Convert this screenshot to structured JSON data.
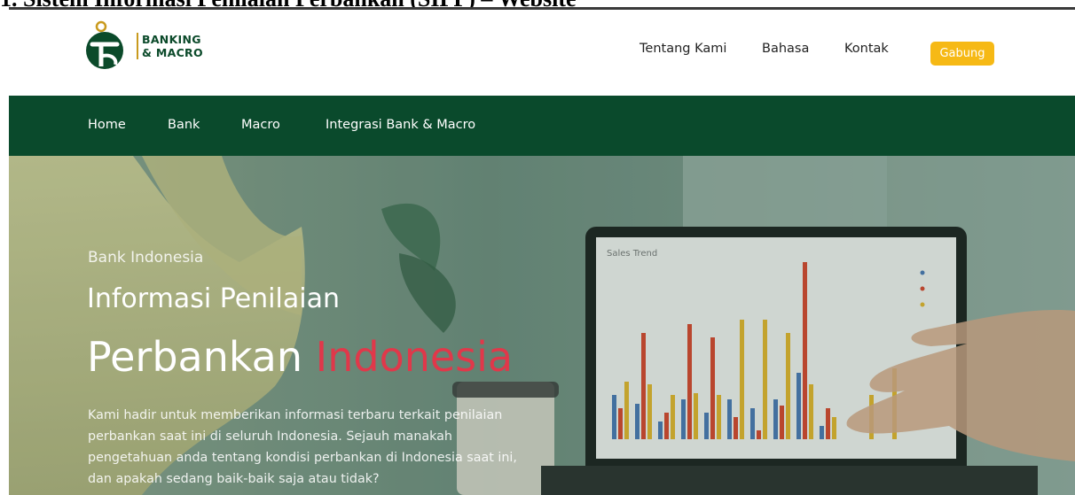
{
  "caption": "1. Sistem Informasi Penilaian Perbankan (SIPP) – Website",
  "brand": {
    "line1": "BANKING",
    "line2": "& MACRO"
  },
  "top_nav": [
    {
      "label": "Tentang Kami"
    },
    {
      "label": "Bahasa"
    },
    {
      "label": "Kontak"
    }
  ],
  "cta": {
    "label": "Gabung"
  },
  "main_nav": [
    {
      "label": "Home"
    },
    {
      "label": "Bank"
    },
    {
      "label": "Macro"
    },
    {
      "label": "Integrasi Bank & Macro"
    }
  ],
  "hero": {
    "eyebrow": "Bank Indonesia",
    "title_line1": "Informasi Penilaian",
    "title_line2_main": "Perbankan",
    "title_line2_accent": "Indonesia",
    "body_lines": [
      "Kami hadir untuk memberikan informasi terbaru terkait penilaian",
      "perbankan saat ini di seluruh Indonesia. Sejauh manakah",
      "pengetahuan anda tentang kondisi perbankan di Indonesia saat ini,",
      "dan apakah sedang baik-baik saja atau tidak?"
    ],
    "screen_label": "Sales Trend"
  },
  "colors": {
    "green": "#0a4a2c",
    "gold": "#f6b915",
    "accent_red": "#e0384a"
  }
}
